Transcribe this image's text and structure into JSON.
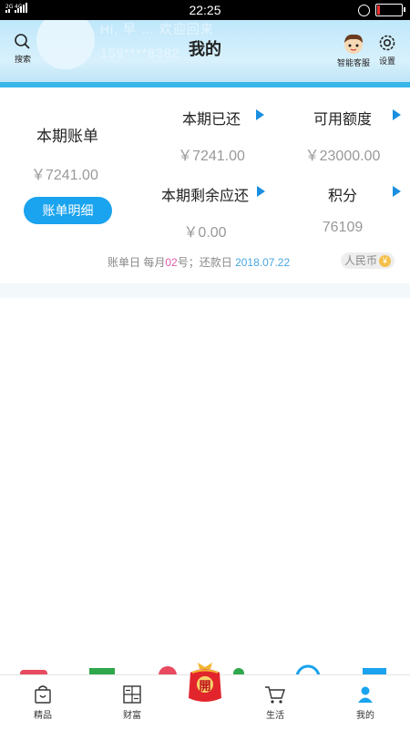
{
  "status_bar": {
    "left_text_top": "2G 4G 4G",
    "time": "22:25"
  },
  "header": {
    "title": "我的",
    "search_label": "搜索",
    "service_label": "智能客服",
    "settings_label": "设置",
    "ghost_line_1": "Hi, 早 … 欢迎回来",
    "ghost_line_2": "159****8382"
  },
  "card": {
    "bill_label": "本期账单",
    "bill_amount": "￥7241.00",
    "detail_button": "账单明细",
    "stats": [
      {
        "label": "本期已还",
        "value": "￥7241.00"
      },
      {
        "label": "可用额度",
        "value": "￥23000.00"
      },
      {
        "label": "本期剩余应还",
        "value": "￥0.00"
      },
      {
        "label": "积分",
        "value": "76109"
      }
    ],
    "info": {
      "statement_prefix": "账单日  每月",
      "statement_day": "02",
      "statement_suffix": "号；还款日",
      "due_date": "2018.07.22"
    },
    "currency_label": "人民币",
    "currency_symbol": "¥"
  },
  "bottom_nav": {
    "center_badge": "開",
    "items": [
      {
        "label": "精品",
        "icon": "shopping-bag-icon"
      },
      {
        "label": "财富",
        "icon": "calculator-icon"
      },
      {
        "label": "生活",
        "icon": "cart-icon"
      },
      {
        "label": "我的",
        "icon": "person-icon"
      }
    ]
  },
  "colors": {
    "accent": "#1aa3ee",
    "header_bg": "#c9ecfb",
    "arrow": "#1a8fe0",
    "highlight_pink": "#e35aa8",
    "date_blue": "#4aa6e2"
  }
}
